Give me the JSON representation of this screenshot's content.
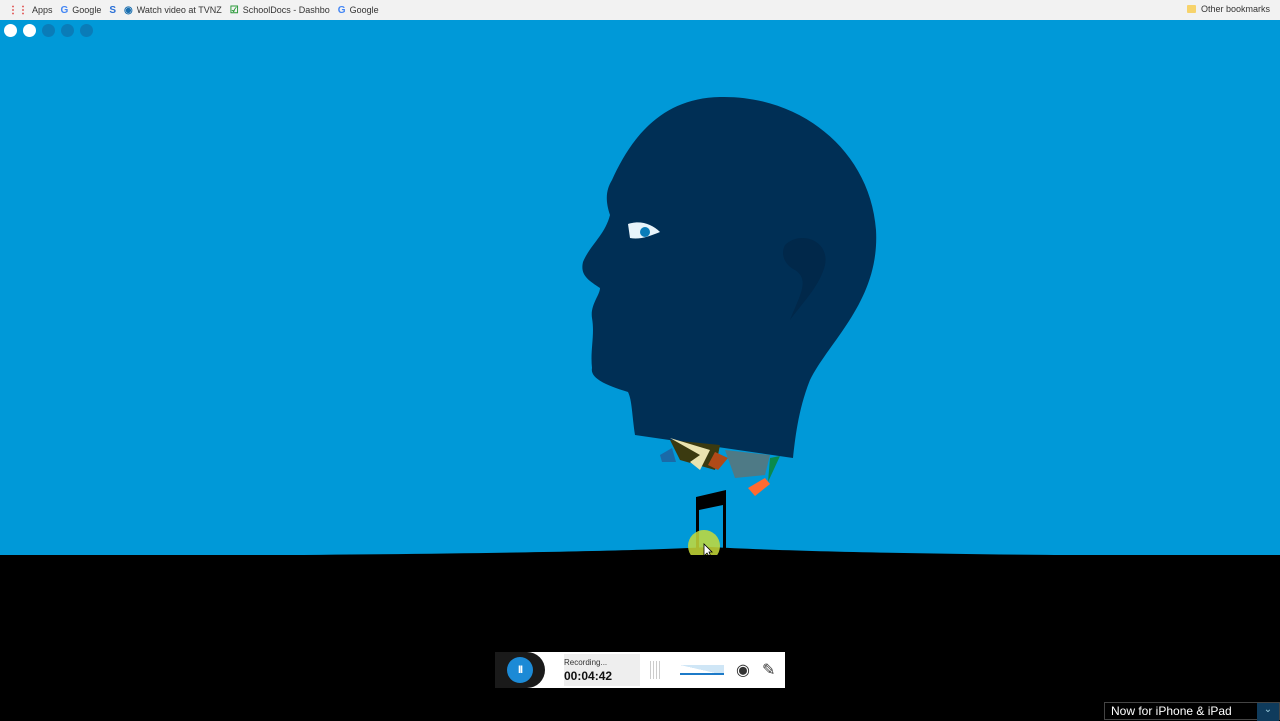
{
  "bookmarks": {
    "items": [
      {
        "label": "Apps",
        "icon": "apps-grid-icon"
      },
      {
        "label": "Google",
        "icon": "google-icon"
      },
      {
        "label": "",
        "icon": "s-logo-icon"
      },
      {
        "label": "Watch video at TVNZ",
        "icon": "tvnz-icon"
      },
      {
        "label": "SchoolDocs - Dashbo",
        "icon": "checkbox-icon"
      },
      {
        "label": "Google",
        "icon": "google-icon"
      }
    ],
    "other": "Other bookmarks"
  },
  "slides": {
    "total": 5,
    "active": [
      0,
      1
    ]
  },
  "recorder": {
    "status": "Recording...",
    "time": "00:04:42",
    "pause_symbol": "II"
  },
  "promo": {
    "label": "Now for iPhone & iPad"
  },
  "colors": {
    "sky": "#0099d8",
    "head": "#002f55",
    "accent": "#1c8ad6"
  }
}
